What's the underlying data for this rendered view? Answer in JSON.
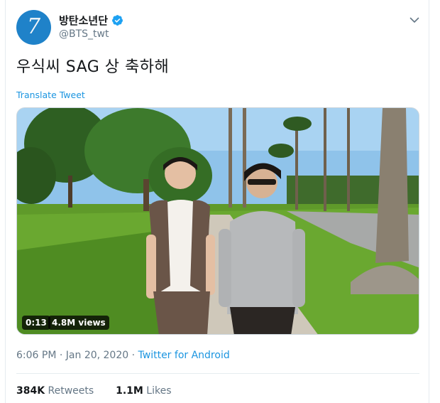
{
  "tweet": {
    "display_name": "방탄소년단",
    "handle": "@BTS_twt",
    "avatar_text": "7",
    "verified": true,
    "text": "우식씨 SAG 상 축하해",
    "translate_label": "Translate Tweet",
    "media": {
      "time_badge": "0:13",
      "views_badge": "4.8M views"
    },
    "meta": {
      "time": "6:06 PM",
      "date": "Jan 20, 2020",
      "separator": "·",
      "source": "Twitter for Android"
    },
    "stats": {
      "retweets_count": "384K",
      "retweets_label": "Retweets",
      "likes_count": "1.1M",
      "likes_label": "Likes"
    }
  },
  "colors": {
    "link_blue": "#1b95e0",
    "avatar_blue": "#1f82c9",
    "muted_text": "#657786",
    "primary_text": "#14171a"
  },
  "icons": {
    "verified": "verified-badge-icon",
    "caret": "chevron-down-icon"
  }
}
